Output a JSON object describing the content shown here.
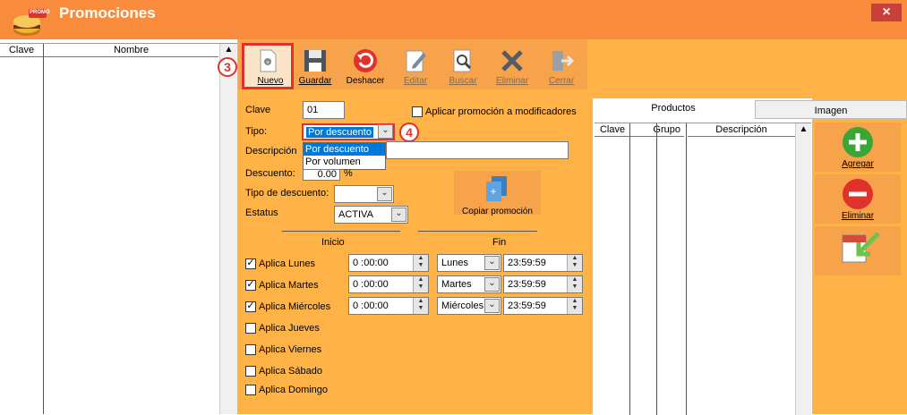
{
  "window": {
    "title": "Promociones",
    "close_label": "×",
    "logo_badge": "PROMO"
  },
  "left_grid": {
    "columns": [
      "Clave",
      "Nombre"
    ]
  },
  "toolbar": {
    "nuevo": "Nuevo",
    "guardar": "Guardar",
    "deshacer": "Deshacer",
    "editar": "Editar",
    "buscar": "Buscar",
    "eliminar": "Eliminar",
    "cerrar": "Cerrar"
  },
  "form": {
    "clave_label": "Clave",
    "clave_value": "01",
    "aplicar_label": "Aplicar promoción a modificadores",
    "tipo_label": "Tipo:",
    "tipo_value": "Por descuento",
    "tipo_options": [
      "Por descuento",
      "Por volumen"
    ],
    "descripcion_label": "Descripción",
    "descuento_label": "Descuento:",
    "descuento_value": "0.00",
    "descuento_suffix": "%",
    "tipo_descuento_label": "Tipo de descuento:",
    "estatus_label": "Estatus",
    "estatus_value": "ACTIVA",
    "copiar_label": "Copiar promoción"
  },
  "schedule": {
    "inicio_header": "Inicio",
    "fin_header": "Fin",
    "days": [
      {
        "label": "Aplica Lunes",
        "checked": true,
        "start": "0 :00:00",
        "end_day": "Lunes",
        "end_time": "23:59:59"
      },
      {
        "label": "Aplica Martes",
        "checked": true,
        "start": "0 :00:00",
        "end_day": "Martes",
        "end_time": "23:59:59"
      },
      {
        "label": "Aplica Miércoles",
        "checked": true,
        "start": "0 :00:00",
        "end_day": "Miércoles",
        "end_time": "23:59:59"
      },
      {
        "label": "Aplica Jueves",
        "checked": false
      },
      {
        "label": "Aplica Viernes",
        "checked": false
      },
      {
        "label": "Aplica Sábado",
        "checked": false
      },
      {
        "label": "Aplica Domingo",
        "checked": false
      }
    ]
  },
  "right": {
    "tabs": [
      "Productos",
      "Imagen"
    ],
    "columns": [
      "Clave",
      "Grupo",
      "Descripción"
    ],
    "agregar": "Agregar",
    "eliminar": "Eliminar"
  },
  "markers": {
    "m3": "3",
    "m4": "4"
  },
  "colors": {
    "titlebar": "#f98c3c",
    "panel": "#ffb347",
    "highlight": "#e0322a",
    "selection": "#0078d7"
  }
}
